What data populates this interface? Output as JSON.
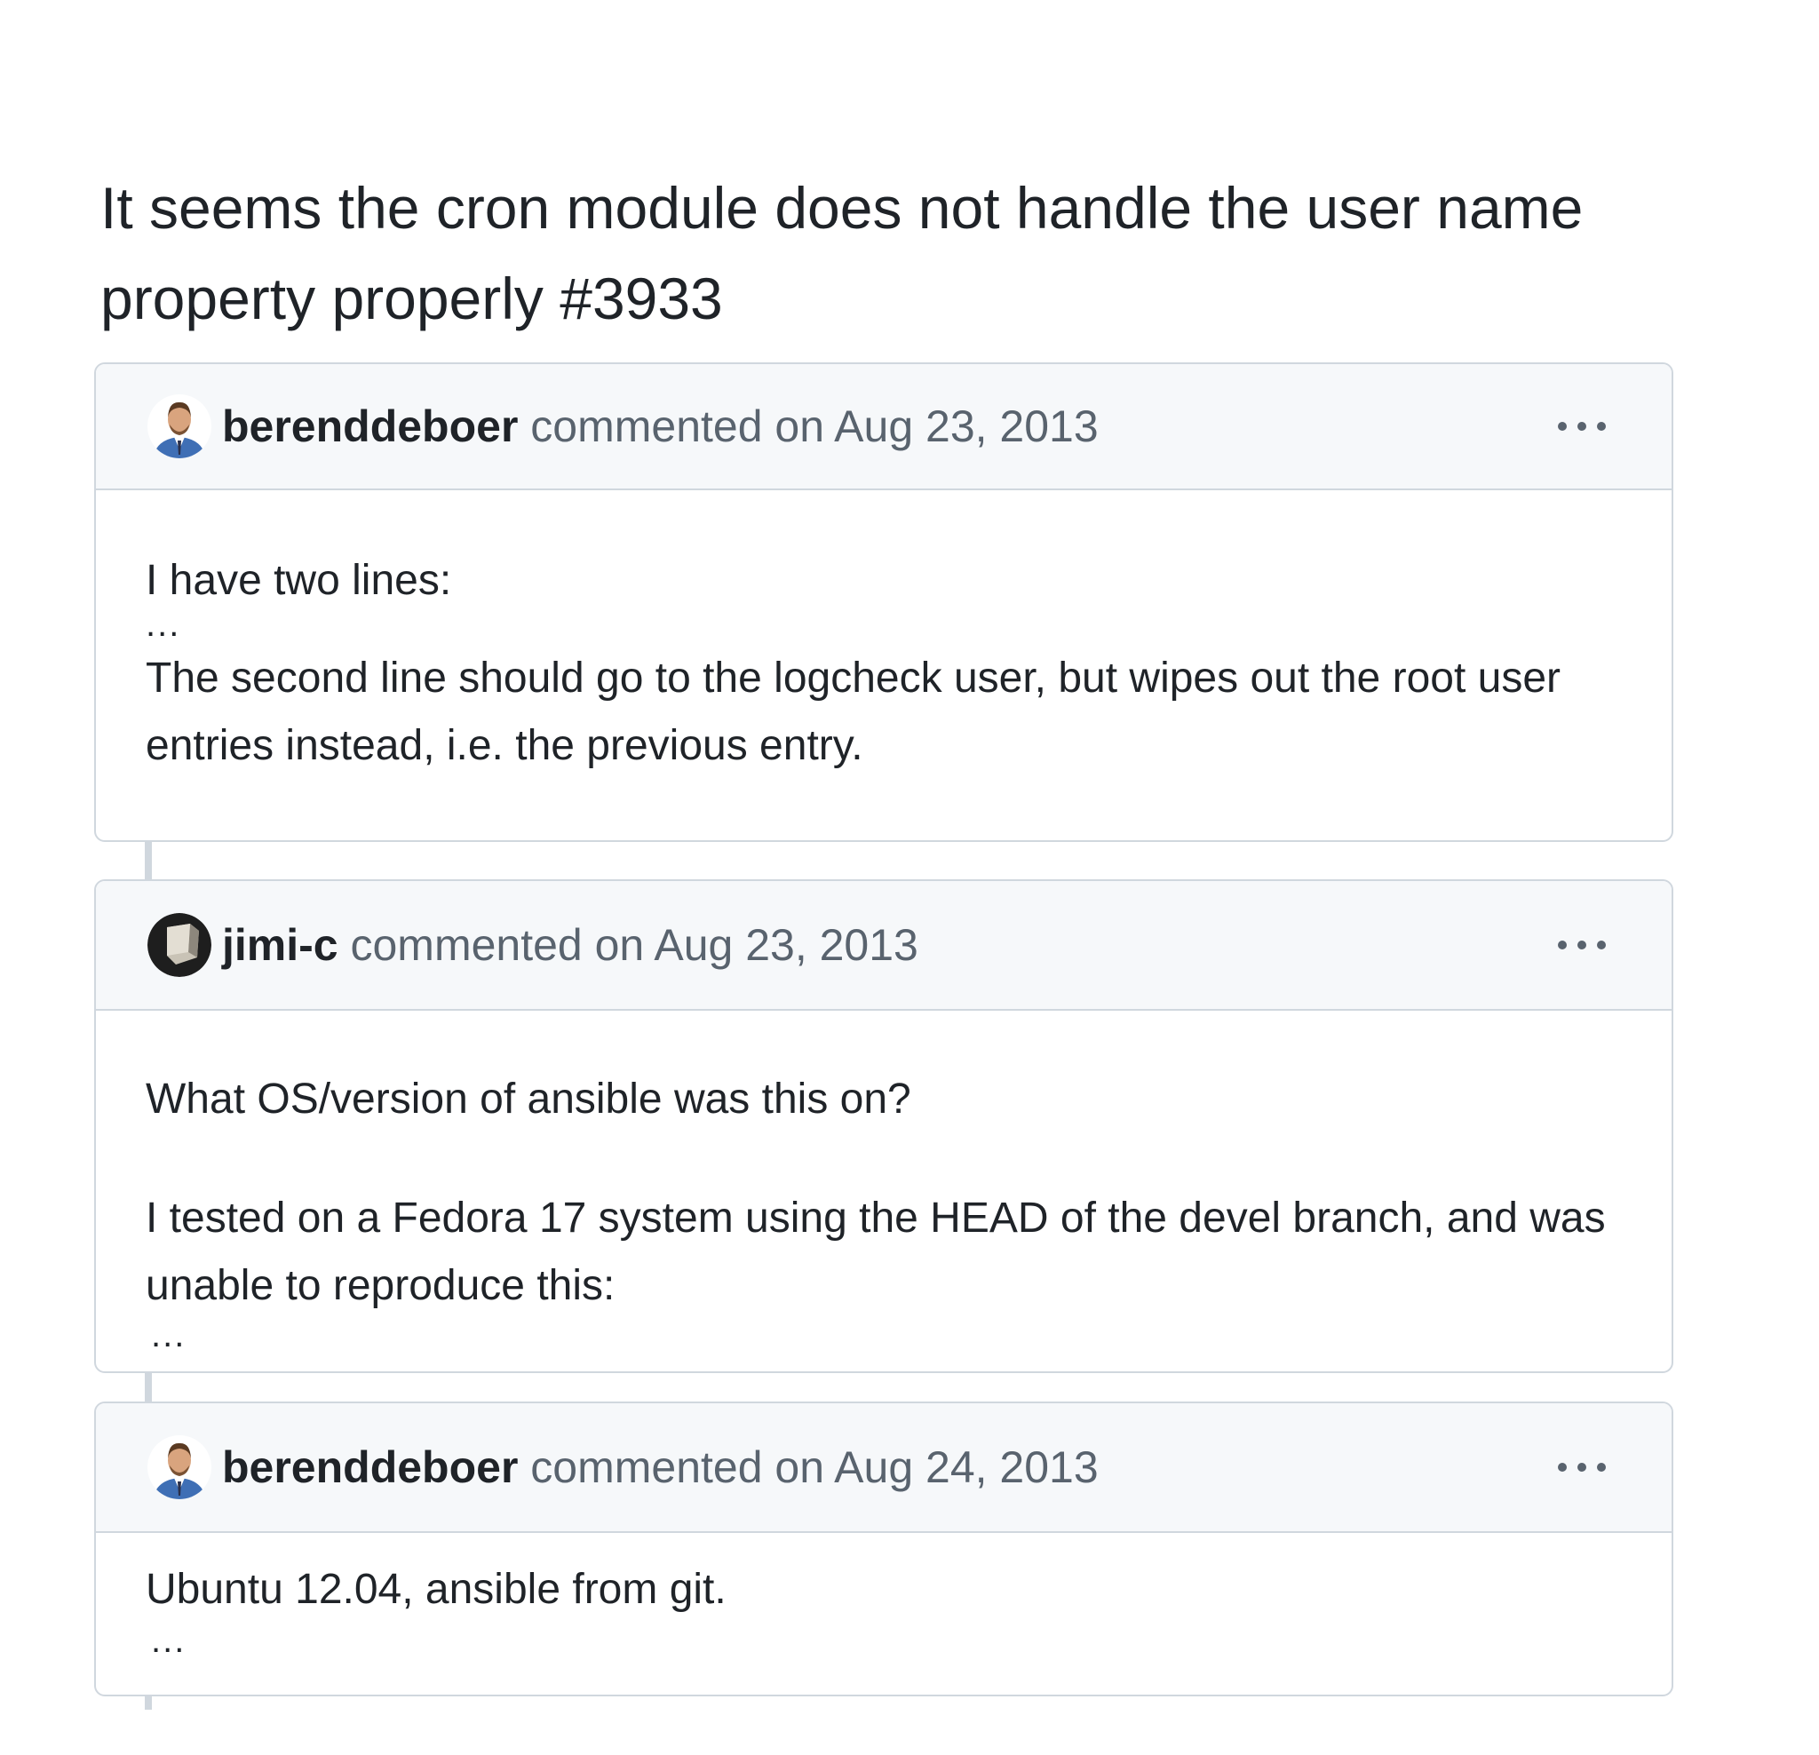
{
  "issue": {
    "title": "It seems the cron module does not handle the user name property properly #3933"
  },
  "comments": [
    {
      "author": "berenddeboer",
      "meta": " commented on Aug 23, 2013",
      "avatar": "avatar-photo-man",
      "menu_icon": "kebab-menu-icon",
      "body": {
        "line1": "I have two lines:",
        "ellipsis1": "...",
        "line2": "The second line should go to the logcheck user, but wipes out the root user entries instead, i.e. the previous entry."
      }
    },
    {
      "author": "jimi-c",
      "meta": " commented on Aug 23, 2013",
      "avatar": "avatar-photo-cube",
      "menu_icon": "kebab-menu-icon",
      "body": {
        "line1": "What OS/version of ansible was this on?",
        "line2": "I tested on a Fedora 17 system using the HEAD of the devel branch, and was unable to reproduce this:",
        "ellipsis1": "..."
      }
    },
    {
      "author": "berenddeboer",
      "meta": " commented on Aug 24, 2013",
      "avatar": "avatar-photo-man",
      "menu_icon": "kebab-menu-icon",
      "body": {
        "line1": "Ubuntu 12.04, ansible from git.",
        "ellipsis1": "..."
      }
    }
  ],
  "colors": {
    "border": "#d0d7de",
    "header_bg": "#f6f8fa",
    "text": "#1f2328",
    "muted": "#59636e"
  }
}
